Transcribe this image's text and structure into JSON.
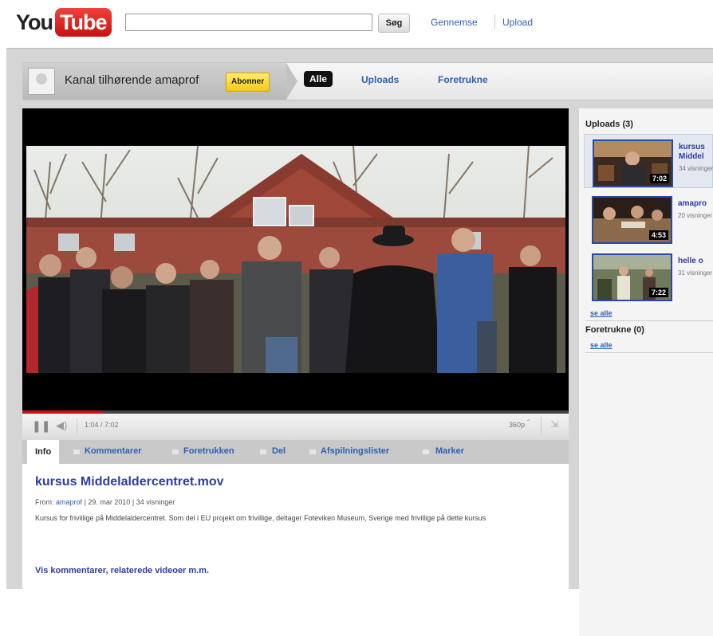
{
  "header": {
    "logo_you": "You",
    "logo_tube": "Tube",
    "search_placeholder": "",
    "search_button": "Søg",
    "browse_link": "Gennemse",
    "upload_link": "Upload"
  },
  "channel": {
    "owner_text": "Kanal tilhørende amaprof",
    "subscribe_button": "Abonner",
    "tabs": [
      {
        "label": "Alle",
        "active": true
      },
      {
        "label": "Uploads",
        "active": false
      },
      {
        "label": "Foretrukne",
        "active": false
      }
    ]
  },
  "player": {
    "progress_fraction": 0.148,
    "time_display": "1:04 / 7:02",
    "quality": "360p"
  },
  "info_tabs": [
    {
      "label": "Info",
      "active": true
    },
    {
      "label": "Kommentarer"
    },
    {
      "label": "Foretrukken"
    },
    {
      "label": "Del"
    },
    {
      "label": "Afspilningslister"
    },
    {
      "label": "Marker"
    }
  ],
  "video": {
    "title": "kursus Middelaldercentret.mov",
    "meta_from": "From:",
    "meta_user": "amaprof",
    "meta_rest": "| 29. mar 2010 | 34 visninger",
    "description": "Kursus for frivillige på Middelaldercentret. Som del i EU projekt om frivillige, deltager Foteviken Museum, Sverige med frivillige på dette kursus",
    "more_link": "Vis kommentarer, relaterede videoer m.m."
  },
  "sidebar": {
    "uploads_heading": "Uploads (3)",
    "items": [
      {
        "title": "kursus Middel",
        "views": "34 visninger",
        "duration": "7:02",
        "selected": true
      },
      {
        "title": "amapro",
        "views": "20 visninger",
        "duration": "4:53",
        "selected": false
      },
      {
        "title": "helle o",
        "views": "31 visninger",
        "duration": "7:22",
        "selected": false
      }
    ],
    "see_all_1": "se alle",
    "favorites_heading": "Foretrukne (0)",
    "see_all_2": "se alle"
  }
}
